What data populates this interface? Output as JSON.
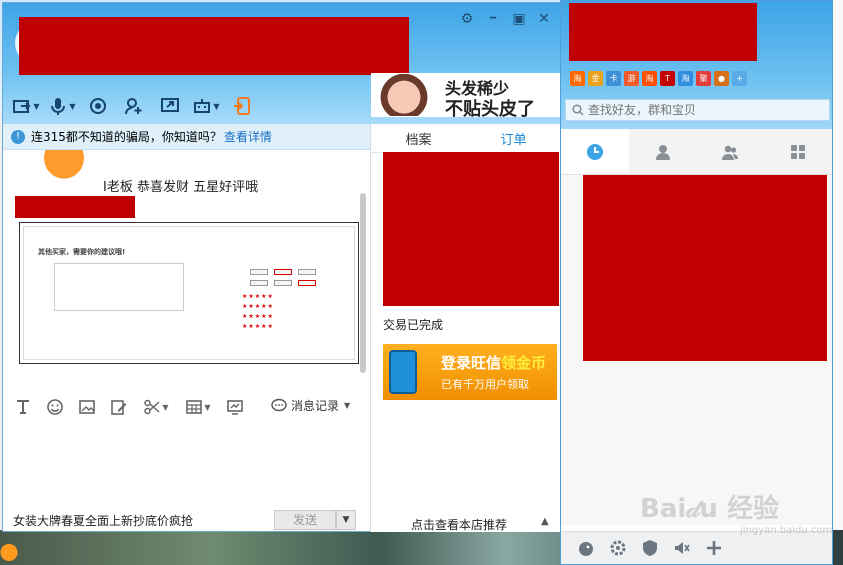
{
  "chat": {
    "window_controls": {
      "settings": "⚙",
      "minimize": "━",
      "maximize": "▣",
      "close": "✕"
    },
    "ad": {
      "line1": "头发稀少",
      "line2": "不贴头皮了"
    },
    "notice": {
      "text": "连315都不知道的骗局，你知道吗？",
      "link": "查看详情"
    },
    "message": {
      "text": "I老板  恭喜发财  五星好评哦"
    },
    "review_screenshot": {
      "title": "其他买家，需要你的建议哦!"
    },
    "history_label": "消息记录",
    "footer_text": "女装大牌春夏全面上新抄底价疯抢",
    "send_label": "发送"
  },
  "side_panel": {
    "tabs": [
      {
        "label": "档案",
        "active": false
      },
      {
        "label": "订单",
        "active": true
      }
    ],
    "trade_status": "交易已完成",
    "promo": {
      "line1_a": "登录旺信",
      "line1_b": "领金币",
      "line2": "已有千万用户领取"
    },
    "shop_link": "点击查看本店推荐"
  },
  "wangwang": {
    "search_placeholder": "查找好友，群和宝贝",
    "apps": [
      {
        "name": "taobao",
        "glyph": "淘",
        "color": "#ff6a00"
      },
      {
        "name": "coin",
        "glyph": "金",
        "color": "#e9a21b"
      },
      {
        "name": "card",
        "glyph": "卡",
        "color": "#3d8fd6"
      },
      {
        "name": "game",
        "glyph": "游",
        "color": "#f05a28"
      },
      {
        "name": "taobao2",
        "glyph": "淘",
        "color": "#ff5000"
      },
      {
        "name": "tmall",
        "glyph": "T",
        "color": "#c40000"
      },
      {
        "name": "taobao3",
        "glyph": "淘",
        "color": "#2f8ee0"
      },
      {
        "name": "ju",
        "glyph": "聚",
        "color": "#e23c3c"
      },
      {
        "name": "ad",
        "glyph": "●",
        "color": "#d6701a"
      },
      {
        "name": "add",
        "glyph": "+",
        "color": "#5aaae6"
      }
    ],
    "tabs": [
      {
        "name": "recent-icon",
        "active": true
      },
      {
        "name": "contacts-icon",
        "active": false
      },
      {
        "name": "groups-icon",
        "active": false
      },
      {
        "name": "apps-grid-icon",
        "active": false
      }
    ]
  },
  "watermark": {
    "brand": "Bai𝒹u 经验",
    "sub": "jingyan.baidu.com"
  },
  "colors": {
    "accent": "#3ea4e7",
    "redact": "#c00000",
    "link": "#1a6fc2"
  }
}
